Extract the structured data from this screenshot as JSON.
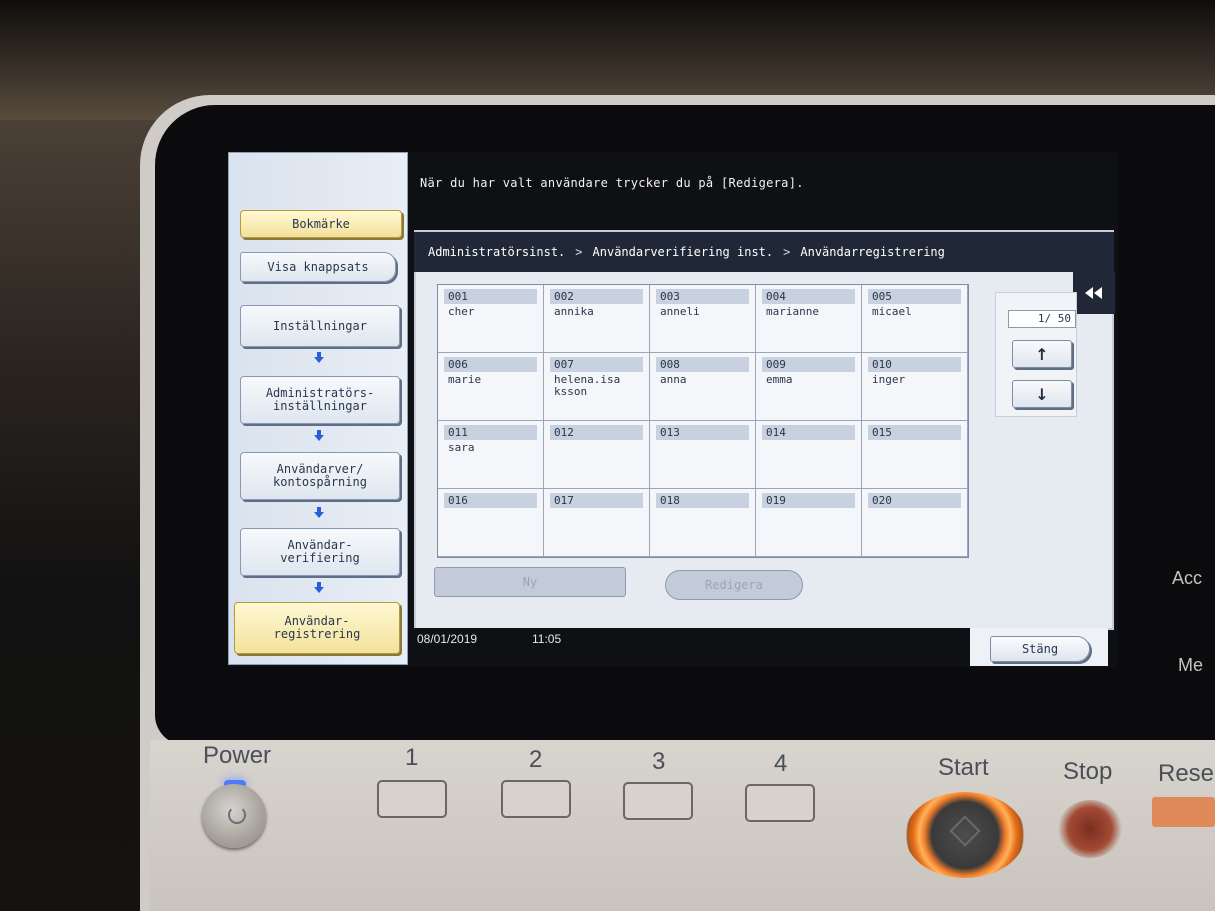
{
  "instruction": "När du har valt användare trycker du på [Redigera].",
  "left_nav": {
    "bookmark_label": "Bokmärke",
    "show_keypad_label": "Visa knappsats",
    "steps": [
      {
        "label": "Inställningar"
      },
      {
        "label": "Administratörs-\ninställningar"
      },
      {
        "label": "Användarver/\nkontospårning"
      },
      {
        "label": "Användar-\nverifiering"
      },
      {
        "label": "Användar-\nregistrering"
      }
    ]
  },
  "breadcrumb": {
    "items": [
      "Administratörsinst.",
      "Användarverifiering inst.",
      "Användarregistrering"
    ],
    "separator": ">"
  },
  "collapse_icon": "double-left-arrow",
  "users": [
    {
      "num": "001",
      "name": "cher"
    },
    {
      "num": "002",
      "name": "annika"
    },
    {
      "num": "003",
      "name": "anneli"
    },
    {
      "num": "004",
      "name": "marianne"
    },
    {
      "num": "005",
      "name": "micael"
    },
    {
      "num": "006",
      "name": "marie"
    },
    {
      "num": "007",
      "name": "helena.isa\nksson"
    },
    {
      "num": "008",
      "name": "anna"
    },
    {
      "num": "009",
      "name": "emma"
    },
    {
      "num": "010",
      "name": "inger"
    },
    {
      "num": "011",
      "name": "sara"
    },
    {
      "num": "012",
      "name": ""
    },
    {
      "num": "013",
      "name": ""
    },
    {
      "num": "014",
      "name": ""
    },
    {
      "num": "015",
      "name": ""
    },
    {
      "num": "016",
      "name": ""
    },
    {
      "num": "017",
      "name": ""
    },
    {
      "num": "018",
      "name": ""
    },
    {
      "num": "019",
      "name": ""
    },
    {
      "num": "020",
      "name": ""
    }
  ],
  "pager": {
    "page_indicator": "1/ 50",
    "up_glyph": "↑",
    "down_glyph": "↓"
  },
  "actions": {
    "new_label": "Ny",
    "edit_label": "Redigera"
  },
  "status": {
    "date": "08/01/2019",
    "time": "11:05"
  },
  "close_label": "Stäng",
  "right_edge": {
    "label1": "Acc",
    "label2": "Me"
  },
  "hardware": {
    "power_label": "Power",
    "keys": [
      "1",
      "2",
      "3",
      "4"
    ],
    "start_label": "Start",
    "stop_label": "Stop",
    "reset_label": "Rese"
  }
}
